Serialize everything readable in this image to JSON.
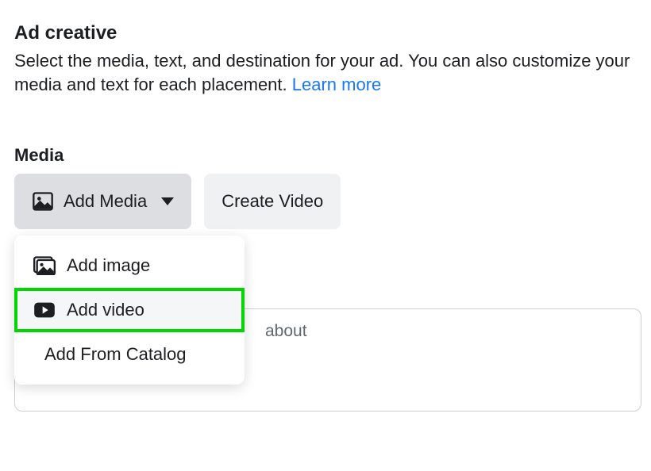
{
  "header": {
    "title": "Ad creative",
    "desc_pre": "Select the media, text, and destination for your ad. You can also customize your media and text for each placement. ",
    "learn_more": "Learn more"
  },
  "media": {
    "label": "Media",
    "add_media_label": "Add Media",
    "create_video_label": "Create Video",
    "dropdown": {
      "add_image": "Add image",
      "add_video": "Add video",
      "add_from_catalog": "Add From Catalog"
    }
  },
  "input": {
    "visible_placeholder_fragment": "about"
  }
}
